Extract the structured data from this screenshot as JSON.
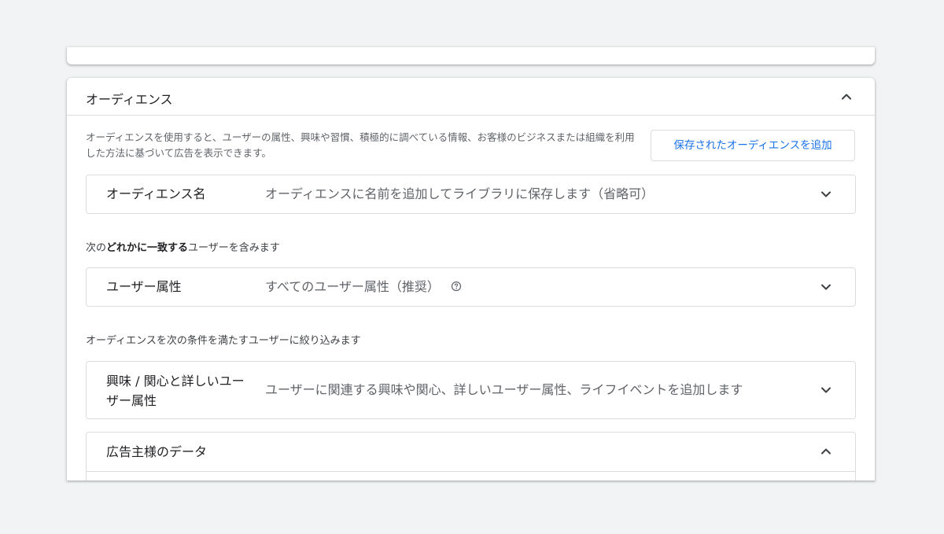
{
  "card": {
    "title": "オーディエンス",
    "description": "オーディエンスを使用すると、ユーザーの属性、興味や習慣、積極的に調べている情報、お客様のビジネスまたは組織を利用した方法に基づいて広告を表示できます。",
    "add_saved_button": "保存されたオーディエンスを追加"
  },
  "audience_name": {
    "label": "オーディエンス名",
    "value": "オーディエンスに名前を追加してライブラリに保存します（省略可）"
  },
  "include_section": {
    "prefix": "次の",
    "bold": "どれかに一致する",
    "suffix": "ユーザーを含みます"
  },
  "demographics": {
    "label": "ユーザー属性",
    "value": "すべてのユーザー属性（推奨）"
  },
  "narrow_section": {
    "text": "オーディエンスを次の条件を満たすユーザーに絞り込みます"
  },
  "interests": {
    "label": "興味 / 関心と詳しいユーザー属性",
    "value": "ユーザーに関連する興味や関心、詳しいユーザー属性、ライフイベントを追加します"
  },
  "advertiser_data": {
    "label": "広告主様のデータ"
  },
  "icons": {
    "collapse": "chevron-up-icon",
    "expand": "chevron-down-icon",
    "help": "help-circle-icon"
  },
  "colors": {
    "accent": "#1a73e8",
    "border": "#dadce0",
    "background": "#f1f3f4"
  }
}
